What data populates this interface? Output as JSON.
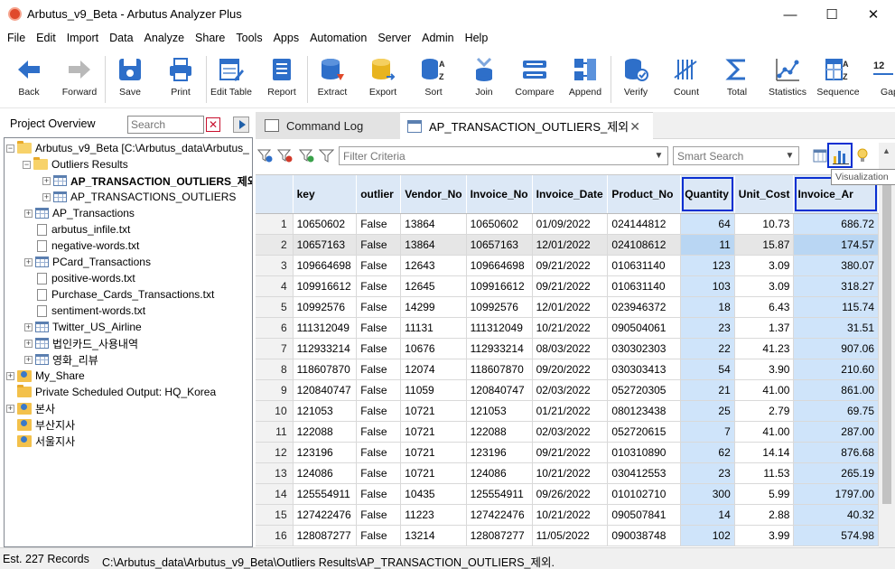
{
  "window": {
    "title": "Arbutus_v9_Beta - Arbutus Analyzer Plus",
    "minimize_glyph": "—",
    "maximize_glyph": "☐",
    "close_glyph": "✕"
  },
  "menu": [
    "File",
    "Edit",
    "Import",
    "Data",
    "Analyze",
    "Share",
    "Tools",
    "Apps",
    "Automation",
    "Server",
    "Admin",
    "Help"
  ],
  "toolbar": {
    "buttons": [
      {
        "label": "Back",
        "icon": "arrow-left-icon"
      },
      {
        "label": "Forward",
        "icon": "arrow-right-icon"
      },
      {
        "label": "Save",
        "icon": "save-icon"
      },
      {
        "label": "Print",
        "icon": "print-icon"
      },
      {
        "label": "Edit Table",
        "icon": "edit-table-icon"
      },
      {
        "label": "Report",
        "icon": "report-icon"
      },
      {
        "label": "Extract",
        "icon": "extract-icon"
      },
      {
        "label": "Export",
        "icon": "export-icon"
      },
      {
        "label": "Sort",
        "icon": "sort-icon"
      },
      {
        "label": "Join",
        "icon": "join-icon"
      },
      {
        "label": "Compare",
        "icon": "compare-icon"
      },
      {
        "label": "Append",
        "icon": "append-icon"
      },
      {
        "label": "Verify",
        "icon": "verify-icon"
      },
      {
        "label": "Count",
        "icon": "count-icon"
      },
      {
        "label": "Total",
        "icon": "total-icon"
      },
      {
        "label": "Statistics",
        "icon": "statistics-icon"
      },
      {
        "label": "Sequence",
        "icon": "sequence-icon"
      },
      {
        "label": "Gap",
        "icon": "gap-icon"
      }
    ]
  },
  "left_panel": {
    "title": "Project Overview",
    "search_placeholder": "Search",
    "tree": [
      {
        "label": "Arbutus_v9_Beta [C:\\Arbutus_data\\Arbutus_",
        "type": "folder-open",
        "expander": "−",
        "bold": false
      },
      {
        "label": "Outliers Results",
        "type": "folder-open",
        "expander": "−",
        "bold": false
      },
      {
        "label": "AP_TRANSACTION_OUTLIERS_제외",
        "type": "table",
        "expander": "+",
        "bold": true
      },
      {
        "label": "AP_TRANSACTIONS_OUTLIERS",
        "type": "table",
        "expander": "+",
        "bold": false
      },
      {
        "label": "AP_Transactions",
        "type": "table",
        "expander": "+",
        "bold": false
      },
      {
        "label": "arbutus_infile.txt",
        "type": "text",
        "expander": "",
        "bold": false
      },
      {
        "label": "negative-words.txt",
        "type": "text",
        "expander": "",
        "bold": false
      },
      {
        "label": "PCard_Transactions",
        "type": "table",
        "expander": "+",
        "bold": false
      },
      {
        "label": "positive-words.txt",
        "type": "text",
        "expander": "",
        "bold": false
      },
      {
        "label": "Purchase_Cards_Transactions.txt",
        "type": "text",
        "expander": "",
        "bold": false
      },
      {
        "label": "sentiment-words.txt",
        "type": "text",
        "expander": "",
        "bold": false
      },
      {
        "label": "Twitter_US_Airline",
        "type": "table",
        "expander": "+",
        "bold": false
      },
      {
        "label": "법인카드_사용내역",
        "type": "table",
        "expander": "+",
        "bold": false
      },
      {
        "label": "영화_리뷰",
        "type": "table",
        "expander": "+",
        "bold": false
      },
      {
        "label": "My_Share",
        "type": "share",
        "expander": "+",
        "bold": false
      },
      {
        "label": "Private Scheduled Output:  HQ_Korea",
        "type": "folder",
        "expander": "",
        "bold": false
      },
      {
        "label": "본사",
        "type": "share",
        "expander": "+",
        "bold": false
      },
      {
        "label": "부산지사",
        "type": "share",
        "expander": "",
        "bold": false
      },
      {
        "label": "서울지사",
        "type": "share",
        "expander": "",
        "bold": false
      }
    ]
  },
  "tabs": [
    {
      "label": "Command Log"
    },
    {
      "label": "AP_TRANSACTION_OUTLIERS_제외"
    }
  ],
  "filter": {
    "placeholder": "Filter Criteria",
    "smart_search_placeholder": "Smart Search",
    "visualization_tooltip": "Visualization"
  },
  "grid": {
    "columns": [
      "key",
      "outlier",
      "Vendor_No",
      "Invoice_No",
      "Invoice_Date",
      "Product_No",
      "Quantity",
      "Unit_Cost",
      "Invoice_Amount"
    ],
    "visible_header_override": {
      "Invoice_Amount": "Invoice_Ar"
    },
    "highlighted_columns": [
      "Quantity",
      "Invoice_Amount"
    ],
    "rows": [
      [
        "1",
        "10650602",
        "False",
        "13864",
        "10650602",
        "01/09/2022",
        "024144812",
        "64",
        "10.73",
        "686.72"
      ],
      [
        "2",
        "10657163",
        "False",
        "13864",
        "10657163",
        "12/01/2022",
        "024108612",
        "11",
        "15.87",
        "174.57"
      ],
      [
        "3",
        "109664698",
        "False",
        "12643",
        "109664698",
        "09/21/2022",
        "010631140",
        "123",
        "3.09",
        "380.07"
      ],
      [
        "4",
        "109916612",
        "False",
        "12645",
        "109916612",
        "09/21/2022",
        "010631140",
        "103",
        "3.09",
        "318.27"
      ],
      [
        "5",
        "10992576",
        "False",
        "14299",
        "10992576",
        "12/01/2022",
        "023946372",
        "18",
        "6.43",
        "115.74"
      ],
      [
        "6",
        "111312049",
        "False",
        "11131",
        "111312049",
        "10/21/2022",
        "090504061",
        "23",
        "1.37",
        "31.51"
      ],
      [
        "7",
        "112933214",
        "False",
        "10676",
        "112933214",
        "08/03/2022",
        "030302303",
        "22",
        "41.23",
        "907.06"
      ],
      [
        "8",
        "118607870",
        "False",
        "12074",
        "118607870",
        "09/20/2022",
        "030303413",
        "54",
        "3.90",
        "210.60"
      ],
      [
        "9",
        "120840747",
        "False",
        "11059",
        "120840747",
        "02/03/2022",
        "052720305",
        "21",
        "41.00",
        "861.00"
      ],
      [
        "10",
        "121053",
        "False",
        "10721",
        "121053",
        "01/21/2022",
        "080123438",
        "25",
        "2.79",
        "69.75"
      ],
      [
        "11",
        "122088",
        "False",
        "10721",
        "122088",
        "02/03/2022",
        "052720615",
        "7",
        "41.00",
        "287.00"
      ],
      [
        "12",
        "123196",
        "False",
        "10721",
        "123196",
        "09/21/2022",
        "010310890",
        "62",
        "14.14",
        "876.68"
      ],
      [
        "13",
        "124086",
        "False",
        "10721",
        "124086",
        "10/21/2022",
        "030412553",
        "23",
        "11.53",
        "265.19"
      ],
      [
        "14",
        "125554911",
        "False",
        "10435",
        "125554911",
        "09/26/2022",
        "010102710",
        "300",
        "5.99",
        "1797.00"
      ],
      [
        "15",
        "127422476",
        "False",
        "11223",
        "127422476",
        "10/21/2022",
        "090507841",
        "14",
        "2.88",
        "40.32"
      ],
      [
        "16",
        "128087277",
        "False",
        "13214",
        "128087277",
        "11/05/2022",
        "090038748",
        "102",
        "3.99",
        "574.98"
      ]
    ]
  },
  "status": {
    "records": "Est. 227 Records",
    "path": "C:\\Arbutus_data\\Arbutus_v9_Beta\\Outliers Results\\AP_TRANSACTION_OUTLIERS_제외."
  },
  "colors": {
    "accent": "#0a2fd1",
    "highlight_column": "#cfe4fa",
    "header_bg": "#dce8f6"
  }
}
